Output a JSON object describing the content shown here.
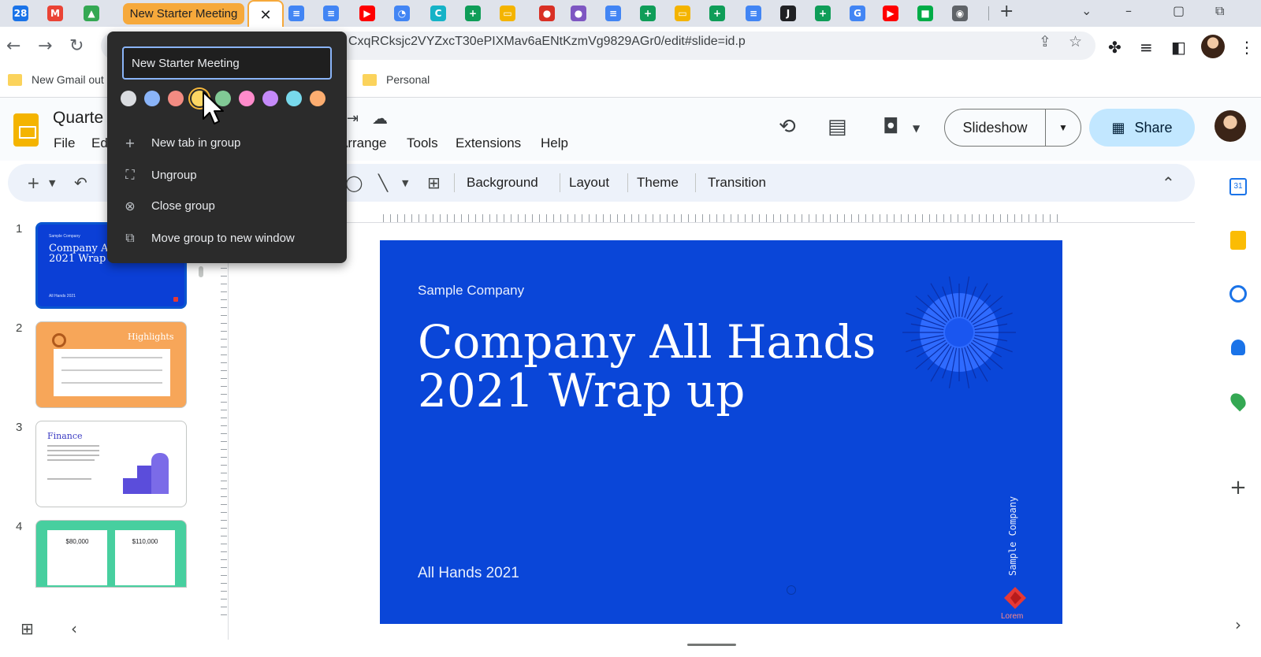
{
  "browser": {
    "tab_group_label": "New Starter Meeting",
    "close_glyph": "✕",
    "tab_favicons": [
      {
        "icon": "calendar-icon",
        "glyph": "28",
        "color": "#1a73e8"
      },
      {
        "icon": "gmail-icon",
        "glyph": "M",
        "color": "#ea4335"
      },
      {
        "icon": "drive-icon",
        "glyph": "▲",
        "color": "#34a853"
      },
      {
        "icon": "docs-icon",
        "glyph": "≡",
        "color": "#4285f4"
      },
      {
        "icon": "docs-icon",
        "glyph": "≡",
        "color": "#4285f4"
      },
      {
        "icon": "youtube-icon",
        "glyph": "▶",
        "color": "#ff0000"
      },
      {
        "icon": "app-icon",
        "glyph": "◔",
        "color": "#4285f4"
      },
      {
        "icon": "canva-icon",
        "glyph": "C",
        "color": "#16b3c7"
      },
      {
        "icon": "sheets-icon",
        "glyph": "+",
        "color": "#0f9d58"
      },
      {
        "icon": "slides-icon",
        "glyph": "▭",
        "color": "#f4b400"
      },
      {
        "icon": "record-icon",
        "glyph": "●",
        "color": "#d93025"
      },
      {
        "icon": "app-icon",
        "glyph": "●",
        "color": "#7e57c2"
      },
      {
        "icon": "docs-icon",
        "glyph": "≡",
        "color": "#4285f4"
      },
      {
        "icon": "sheets-icon",
        "glyph": "+",
        "color": "#0f9d58"
      },
      {
        "icon": "slides-icon",
        "glyph": "▭",
        "color": "#f4b400"
      },
      {
        "icon": "sheets-icon",
        "glyph": "+",
        "color": "#0f9d58"
      },
      {
        "icon": "docs-icon",
        "glyph": "≡",
        "color": "#4285f4"
      },
      {
        "icon": "jamboard-icon",
        "glyph": "J",
        "color": "#202124"
      },
      {
        "icon": "sheets-icon",
        "glyph": "+",
        "color": "#0f9d58"
      },
      {
        "icon": "google-icon",
        "glyph": "G",
        "color": "#4285f4"
      },
      {
        "icon": "youtube-icon",
        "glyph": "▶",
        "color": "#ff0000"
      },
      {
        "icon": "chat-icon",
        "glyph": "■",
        "color": "#00ac47"
      },
      {
        "icon": "chrome-icon",
        "glyph": "◉",
        "color": "#5f6368"
      }
    ],
    "url": "CxqRCksjc2VYZxcT30ePIXMav6aENtKzmVg9829AGr0/edit#slide=id.p",
    "bookmarks": [
      "New Gmail out",
      "Personal"
    ]
  },
  "app": {
    "doc_title": "Quarte",
    "menu": [
      "File",
      "Ed",
      "Arrange",
      "Tools",
      "Extensions",
      "Help"
    ],
    "slideshow_label": "Slideshow",
    "share_label": "Share",
    "toolbar_text": [
      "Background",
      "Layout",
      "Theme",
      "Transition"
    ]
  },
  "popup": {
    "name_value": "New Starter Meeting",
    "colors": [
      "#dadce0",
      "#8ab4f8",
      "#f28b82",
      "#fdd663",
      "#81c995",
      "#ff8bcb",
      "#c58af9",
      "#78d9ec",
      "#fcad70"
    ],
    "selected_color_index": 3,
    "items": [
      {
        "icon": "plus-icon",
        "glyph": "+",
        "label": "New tab in group"
      },
      {
        "icon": "ungroup-icon",
        "glyph": "⛶",
        "label": "Ungroup"
      },
      {
        "icon": "close-circle-icon",
        "glyph": "⊗",
        "label": "Close group"
      },
      {
        "icon": "move-window-icon",
        "glyph": "⧉",
        "label": "Move group to new window"
      }
    ]
  },
  "filmstrip": {
    "numbers": [
      "1",
      "2",
      "3",
      "4"
    ],
    "thumb1": {
      "company": "Sample Company",
      "title_line1": "Company Al",
      "title_line2": "2021 Wrap u",
      "footer": "All Hands 2021"
    },
    "thumb2": {
      "title": "Highlights"
    },
    "thumb3": {
      "title": "Finance"
    },
    "thumb4": {
      "left_value": "$80,000",
      "right_value": "$110,000"
    }
  },
  "slide": {
    "company": "Sample Company",
    "title_line1": "Company All Hands",
    "title_line2": "2021 Wrap up",
    "footer": "All Hands 2021",
    "vertical_text": "Sample Company",
    "logo_text": "Lorem"
  }
}
